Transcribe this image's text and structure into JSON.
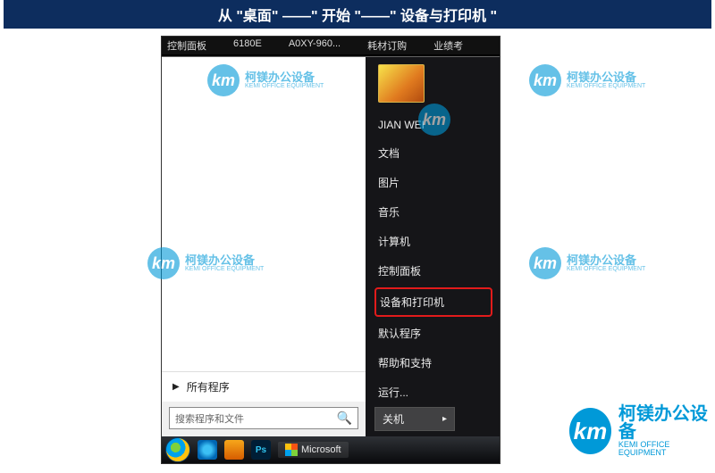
{
  "title_bar": "从 \"桌面\" ——\" 开始 \"——\" 设备与打印机 \"",
  "desktop": {
    "icons": [
      "控制面板",
      "6180E",
      "A0XY-960...",
      "耗材订购",
      "业绩考"
    ]
  },
  "startmenu": {
    "all_programs": "所有程序",
    "search_placeholder": "搜索程序和文件",
    "username": "JIAN WEI",
    "items": [
      "文档",
      "图片",
      "音乐",
      "计算机",
      "控制面板",
      "设备和打印机",
      "默认程序",
      "帮助和支持",
      "运行..."
    ],
    "highlight_index": 5,
    "shutdown": "关机"
  },
  "taskbar": {
    "ps": "Ps",
    "task_label": "Microsoft"
  },
  "watermark": {
    "logo": "km",
    "cn": "柯镁办公设备",
    "en": "KEMI OFFICE EQUIPMENT"
  }
}
